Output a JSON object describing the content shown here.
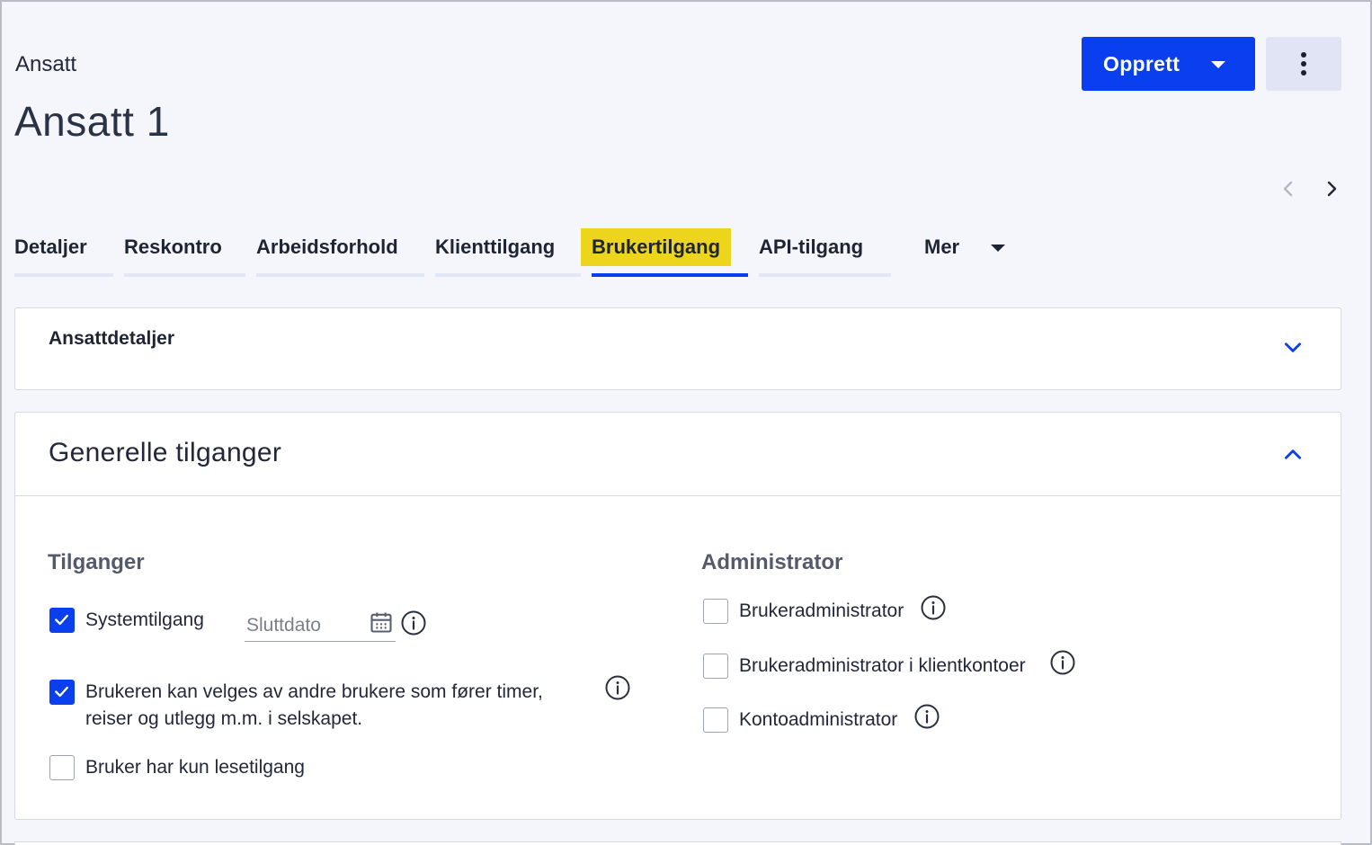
{
  "header": {
    "breadcrumb": "Ansatt",
    "title": "Ansatt 1",
    "create_button": "Opprett",
    "more_button_icon": "vertical-ellipsis-icon",
    "prev_icon": "chevron-left-icon",
    "next_icon": "chevron-right-icon"
  },
  "tabs": [
    {
      "label": "Detaljer",
      "active": false
    },
    {
      "label": "Reskontro",
      "active": false
    },
    {
      "label": "Arbeidsforhold",
      "active": false
    },
    {
      "label": "Klienttilgang",
      "active": false
    },
    {
      "label": "Brukertilgang",
      "active": true
    },
    {
      "label": "API-tilgang",
      "active": false
    },
    {
      "label": "Mer",
      "active": false
    }
  ],
  "cards": {
    "employee_details": {
      "title": "Ansattdetaljer",
      "expanded": false
    },
    "general_access": {
      "title": "Generelle tilganger",
      "expanded": true,
      "access": {
        "heading": "Tilganger",
        "system_access": {
          "label": "Systemtilgang",
          "checked": true
        },
        "end_date_placeholder": "Sluttdato",
        "selectable_by_others": {
          "label_line1": "Brukeren kan velges av andre brukere som fører timer,",
          "label_line2": "reiser og utlegg m.m. i selskapet.",
          "checked": true
        },
        "read_only": {
          "label": "Bruker har kun lesetilgang",
          "checked": false
        }
      },
      "admin": {
        "heading": "Administrator",
        "user_admin": {
          "label": "Brukeradministrator",
          "checked": false
        },
        "user_admin_client": {
          "label": "Brukeradministrator i klientkontoer",
          "checked": false
        },
        "account_admin": {
          "label": "Kontoadministrator",
          "checked": false
        }
      }
    }
  },
  "colors": {
    "primary": "#0a3ff0",
    "highlight": "#ecd51c",
    "background": "#f5f6fb"
  }
}
